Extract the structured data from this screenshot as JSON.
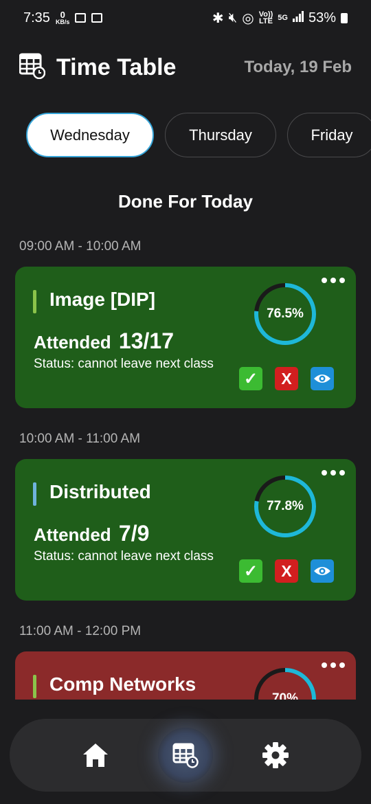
{
  "status_bar": {
    "time": "7:35",
    "net_speed_value": "0",
    "net_speed_unit": "KB/s",
    "volte_top": "Vo))",
    "volte_bottom": "LTE",
    "network": "5G",
    "battery": "53%"
  },
  "header": {
    "title": "Time Table",
    "date": "Today, 19 Feb"
  },
  "tabs": [
    {
      "label": "Wednesday",
      "active": true
    },
    {
      "label": "Thursday",
      "active": false
    },
    {
      "label": "Friday",
      "active": false
    }
  ],
  "section_title": "Done For Today",
  "classes": [
    {
      "time": "09:00 AM - 10:00 AM",
      "subject": "Image [DIP]",
      "attended_label": "Attended",
      "attended_count": "13/17",
      "status": "Status: cannot leave next class",
      "percent_label": "76.5%",
      "percent": 76.5,
      "card_color": "#1f5e1a",
      "accent_color": "#8bc34a"
    },
    {
      "time": "10:00 AM - 11:00 AM",
      "subject": "Distributed",
      "attended_label": "Attended",
      "attended_count": "7/9",
      "status": "Status: cannot leave next class",
      "percent_label": "77.8%",
      "percent": 77.8,
      "card_color": "#1f5e1a",
      "accent_color": "#6fb3dc"
    },
    {
      "time": "11:00 AM - 12:00 PM",
      "subject": "Comp Networks",
      "percent_label": "70%",
      "percent": 70,
      "card_color": "#8b2a2a",
      "accent_color": "#8bc34a"
    }
  ],
  "actions": {
    "present_symbol": "✓",
    "absent_symbol": "X"
  },
  "bottom_nav": [
    {
      "icon": "home-icon",
      "active": false
    },
    {
      "icon": "timetable-icon",
      "active": true
    },
    {
      "icon": "settings-icon",
      "active": false
    }
  ],
  "colors": {
    "background": "#1c1c1e",
    "ring_track": "#1a1a1a",
    "ring_progress": "#1eb8d8",
    "tab_active_border": "#35a4d8"
  }
}
